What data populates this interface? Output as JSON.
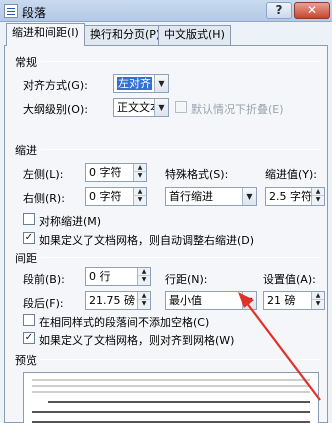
{
  "window": {
    "title": "段落",
    "help_label": "?",
    "close_label": "✕"
  },
  "tabs": [
    {
      "label": "缩进和间距(I)"
    },
    {
      "label": "换行和分页(P)"
    },
    {
      "label": "中文版式(H)"
    }
  ],
  "general": {
    "heading": "常规",
    "alignment_label": "对齐方式(G):",
    "alignment_value": "左对齐",
    "outline_label": "大纲级别(O):",
    "outline_value": "正文文本",
    "collapse_label": "默认情况下折叠(E)"
  },
  "indent": {
    "heading": "缩进",
    "left_label": "左侧(L):",
    "left_value": "0 字符",
    "right_label": "右侧(R):",
    "right_value": "0 字符",
    "special_label": "特殊格式(S):",
    "special_value": "首行缩进",
    "by_label": "缩进值(Y):",
    "by_value": "2.5 字符",
    "mirror_label": "对称缩进(M)",
    "auto_adjust_label": "如果定义了文档网格，则自动调整右缩进(D)",
    "auto_adjust_checked": true
  },
  "spacing": {
    "heading": "间距",
    "before_label": "段前(B):",
    "before_value": "0 行",
    "after_label": "段后(F):",
    "after_value": "21.75 磅",
    "line_label": "行距(N):",
    "line_value": "最小值",
    "at_label": "设置值(A):",
    "at_value": "21 磅",
    "no_space_label": "在相同样式的段落间不添加空格(C)",
    "snap_grid_label": "如果定义了文档网格，则对齐到网格(W)",
    "snap_grid_checked": true
  },
  "preview": {
    "heading": "预览"
  },
  "colors": {
    "accent": "#3170d2",
    "arrow": "#e0322b"
  }
}
